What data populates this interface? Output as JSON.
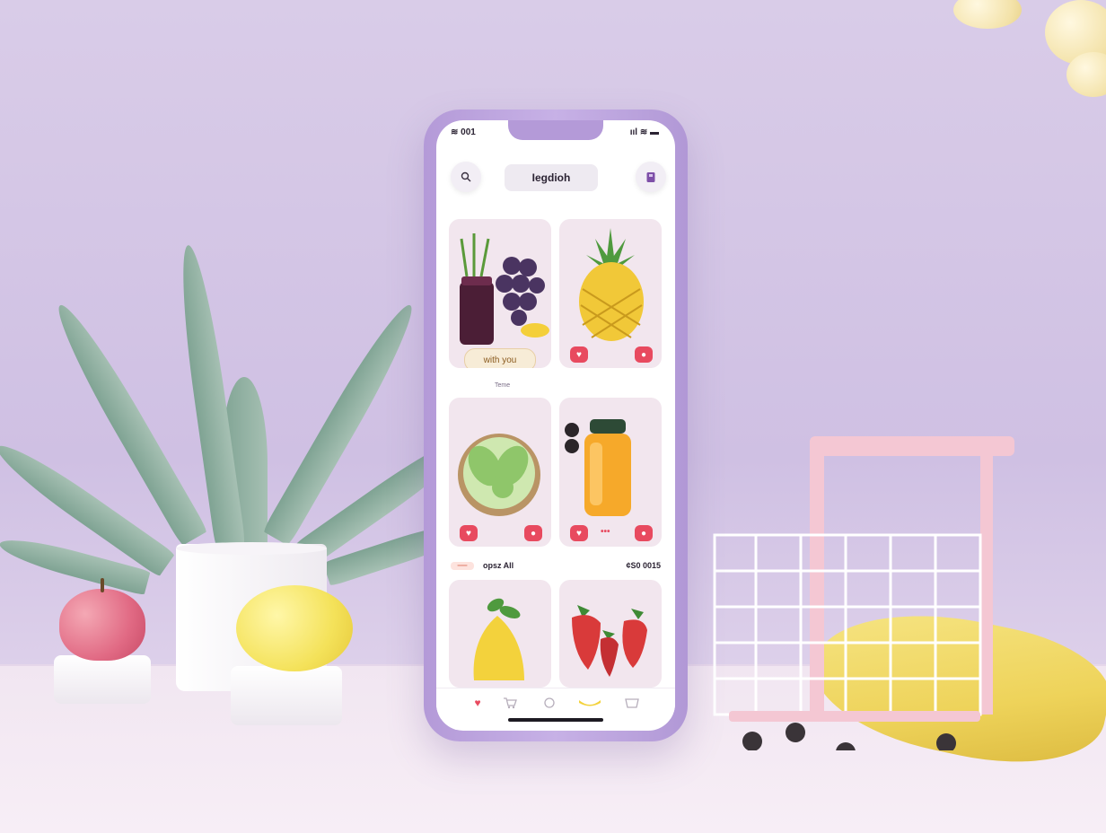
{
  "status_bar": {
    "time": "≋ 001",
    "indicators": "ııl ≋ ▬"
  },
  "header": {
    "search_icon": "search-icon",
    "language_label": "Iegdioh",
    "bag_icon": "bag-icon"
  },
  "product_cards": [
    {
      "fruit": "grapes and juice",
      "badge_label": "with you",
      "caption": "Teme"
    },
    {
      "fruit": "pineapple"
    },
    {
      "fruit": "cabbage bowl"
    },
    {
      "fruit": "orange juice",
      "indicator": "•••"
    },
    {
      "fruit": "lemon"
    },
    {
      "fruit": "strawberries"
    }
  ],
  "section": {
    "tag": "━━━",
    "title": "opsz All",
    "meta": "¢Ѕ0  0015"
  },
  "tab_bar": [
    {
      "icon": "heart-icon"
    },
    {
      "icon": "cart-icon"
    },
    {
      "icon": "circle-icon"
    },
    {
      "icon": "banana-icon"
    },
    {
      "icon": "basket-icon"
    }
  ],
  "colors": {
    "accent": "#b49ad8",
    "heart": "#e84a5f",
    "background": "#d3c5e6"
  }
}
